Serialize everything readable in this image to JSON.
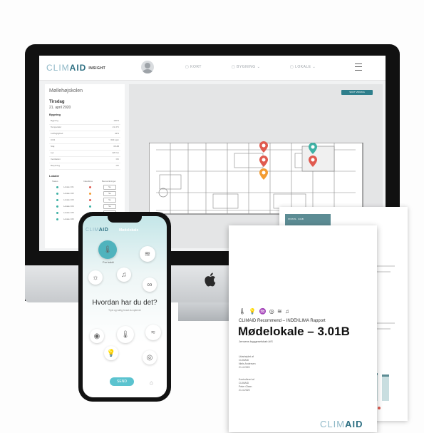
{
  "desktop": {
    "logo_main": "CLIM",
    "logo_bold": "AID",
    "logo_suffix": "INSIGHT",
    "nav": [
      "KORT",
      "BYGNING",
      "LOKALE"
    ],
    "panel": {
      "title": "Møllehøjskolen",
      "day": "Tirsdag",
      "date": "21. april 2020",
      "section_building": "Bygning",
      "rows": [
        {
          "k": "Bygning",
          "v": "100%"
        },
        {
          "k": "Temperatur",
          "v": "21.4°C"
        },
        {
          "k": "Luftfugtighed",
          "v": "42%"
        },
        {
          "k": "CO2",
          "v": "640 ppm"
        },
        {
          "k": "Støj",
          "v": "38 dB"
        },
        {
          "k": "Lys",
          "v": "420 lux"
        },
        {
          "k": "Ventilation",
          "v": "OK"
        },
        {
          "k": "Belysning",
          "v": "OK"
        }
      ],
      "section_locations": "Lokaler",
      "loc_headers": [
        "Status",
        "Indeklima",
        "Bemærkninger"
      ],
      "locations": [
        {
          "label": "Lokale 101",
          "box": "Se"
        },
        {
          "label": "Lokale 102",
          "box": "Se"
        },
        {
          "label": "Lokale 103",
          "box": "Se"
        },
        {
          "label": "Lokale 104",
          "box": "Se"
        },
        {
          "label": "Lokale 105",
          "box": "Se"
        },
        {
          "label": "Lokale 106",
          "box": "Se"
        }
      ]
    },
    "map_button": "SKIFT VISNING"
  },
  "report": {
    "back_header": "STATUS · 3.01B",
    "icons": "🌡 💡 ♒ ◎ ≋ ♫",
    "subtitle": "CLIMAID Recommend – INDEKLIMA Rapport",
    "title": "Mødelokale – 3.01B",
    "line": "Jensens byggeselskab A/S",
    "small_a": "Udarbejdet af\nCLIMAID\nNiels Andersen\n21.4.2020",
    "small_b": "Kontrolleret af\nCLIMAID\nPeter Olsen\n21.4.2020",
    "logo_main": "CLIM",
    "logo_bold": "AID"
  },
  "phone": {
    "logo_main": "CLIM",
    "logo_bold": "AID",
    "place": "Mødelokale",
    "active_label": "For koldt",
    "question": "Hvordan har du det?",
    "hint": "Tryk og vælg hvad du oplever",
    "send": "SEND"
  },
  "colors": {
    "accent": "#2d6f82",
    "teal": "#4fb3bd",
    "marker_red": "#e05a4f",
    "marker_orange": "#f39c32",
    "marker_teal": "#3eb1a4"
  }
}
